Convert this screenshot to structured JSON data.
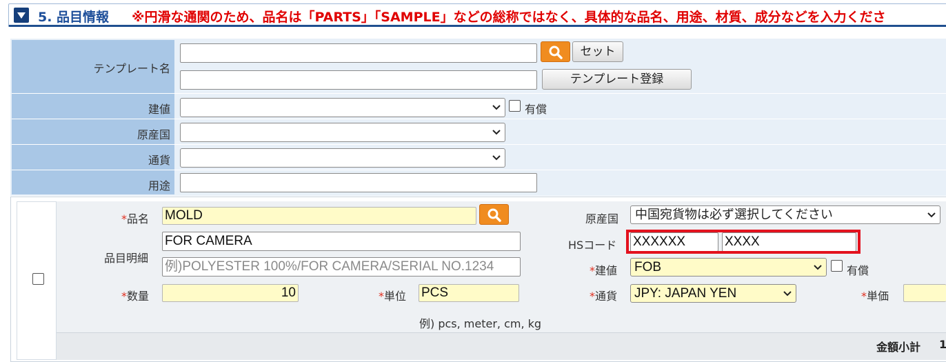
{
  "header": {
    "title": "5. 品目情報",
    "note": "※円滑な通関のため、品名は「PARTS」「SAMPLE」などの総称ではなく、具体的な品名、用途、材質、成分などを入力くださ"
  },
  "template_section": {
    "template_name_label": "テンプレート名",
    "template_search_value": "",
    "set_button": "セット",
    "template_register_value": "",
    "register_button": "テンプレート登録",
    "trade_terms_label": "建値",
    "trade_terms_value": "",
    "paid_label": "有償",
    "origin_label": "原産国",
    "origin_value": "",
    "currency_label": "通貨",
    "currency_value": "",
    "purpose_label": "用途",
    "purpose_value": ""
  },
  "item": {
    "required_mark": "*",
    "name_label": "品名",
    "name_value": "MOLD",
    "detail_label": "品目明細",
    "detail_value": "FOR CAMERA",
    "detail2_placeholder": "例)POLYESTER 100%/FOR CAMERA/SERIAL NO.1234",
    "qty_label": "数量",
    "qty_value": "10",
    "unit_label": "単位",
    "unit_value": "PCS",
    "unit_hint": "例) pcs, meter, cm, kg",
    "origin_label": "原産国",
    "origin_value": "中国宛貨物は必ず選択してください",
    "hs_label": "HSコード",
    "hs_value1": "XXXXXX",
    "hs_value2": "XXXX",
    "trade_terms_label": "建値",
    "trade_terms_value": "FOB",
    "paid_label": "有償",
    "currency_label": "通貨",
    "currency_value": "JPY: JAPAN YEN",
    "unit_price_label": "単価",
    "subtotal_label": "金額小計",
    "subtotal_value": "1"
  },
  "colors": {
    "header_title": "#1e4f9a",
    "header_note": "#e00000",
    "label_bg": "#a9c7e6",
    "row_bg": "#e8f0f8",
    "required_input_bg": "#fffbc8",
    "search_button": "#f08c20",
    "highlight_box": "#e3121e"
  }
}
